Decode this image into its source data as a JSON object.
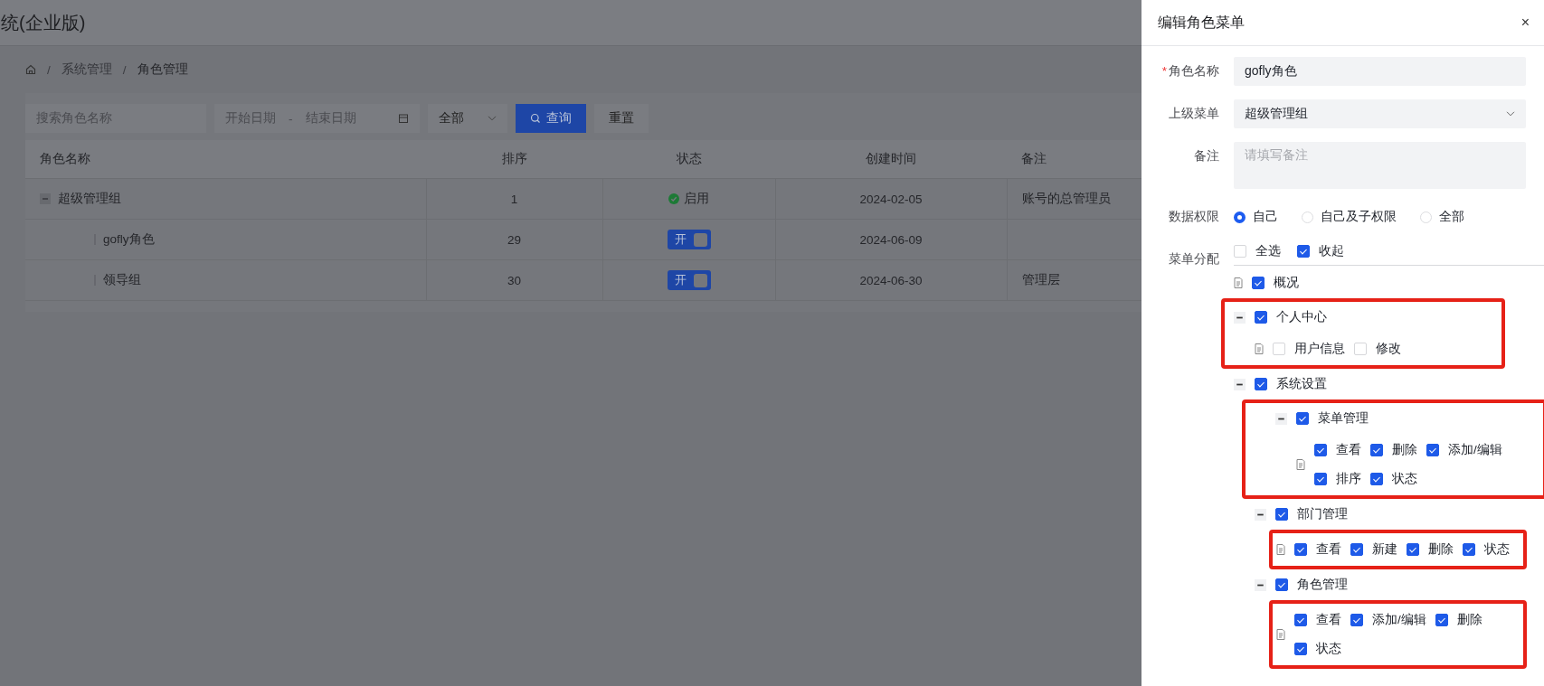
{
  "header": {
    "title": "统(企业版)"
  },
  "breadcrumb": [
    {
      "kind": "home"
    },
    {
      "kind": "link",
      "separator": "/",
      "label": "系统管理"
    },
    {
      "kind": "current",
      "separator": "/",
      "label": "角色管理"
    }
  ],
  "filters": {
    "search": {
      "placeholder": "搜索角色名称"
    },
    "date_range": {
      "start_placeholder": "开始日期",
      "separator": "-",
      "end_placeholder": "结束日期"
    },
    "select": {
      "value": "全部"
    },
    "buttons": [
      {
        "kind": "primary",
        "label": "查询"
      },
      {
        "kind": "default",
        "label": "重置"
      }
    ]
  },
  "table": {
    "columns": [
      "角色名称",
      "排序",
      "状态",
      "创建时间",
      "备注"
    ],
    "rows": [
      {
        "name": "超级管理组",
        "sort": "1",
        "status": {
          "kind": "tag",
          "label": "启用"
        },
        "created": "2024-02-05",
        "note": "账号的总管理员",
        "expanded": true,
        "children": [
          {
            "name": "gofly角色",
            "sort": "29",
            "status": {
              "kind": "switch",
              "label": "开",
              "on": true
            },
            "created": "2024-06-09"
          },
          {
            "name": "领导组",
            "sort": "30",
            "status": {
              "kind": "switch",
              "label": "开",
              "on": true
            },
            "created": "2024-06-30",
            "note": "管理层"
          }
        ]
      }
    ]
  },
  "drawer": {
    "title": "编辑角色菜单",
    "close": "×",
    "role_name": {
      "label": "角色名称",
      "required_mark": "*",
      "value": "gofly角色"
    },
    "parent_menu": {
      "label": "上级菜单",
      "value": "超级管理组"
    },
    "note": {
      "label": "备注",
      "placeholder": "请填写备注"
    },
    "data_scope": {
      "label": "数据权限",
      "options": [
        {
          "label": "自己",
          "selected": true
        },
        {
          "label": "自己及子权限",
          "selected": false
        },
        {
          "label": "全部",
          "selected": false
        }
      ]
    },
    "menu": {
      "label": "菜单分配",
      "toolbar": [
        {
          "label": "全选",
          "checked": false
        },
        {
          "label": "收起",
          "checked": true
        }
      ],
      "tree": [
        {
          "label": "概况",
          "checked": true,
          "framed": false
        },
        {
          "label": "个人中心",
          "checked": true,
          "expanded": true,
          "framed": true,
          "children_framed": false,
          "children": [
            {
              "label": "用户信息",
              "checked": false
            },
            {
              "label": "修改",
              "checked": false
            }
          ]
        },
        {
          "label": "系统设置",
          "checked": true,
          "expanded": true,
          "framed": false,
          "children_framed": false,
          "children": [
            {
              "label": "菜单管理",
              "checked": true,
              "expanded": true,
              "framed": true,
              "children_framed": false,
              "children": [
                {
                  "label": "查看",
                  "checked": true
                },
                {
                  "label": "删除",
                  "checked": true
                },
                {
                  "label": "添加/编辑",
                  "checked": true
                },
                {
                  "label": "排序",
                  "checked": true
                },
                {
                  "label": "状态",
                  "checked": true
                }
              ]
            },
            {
              "label": "部门管理",
              "checked": true,
              "expanded": true,
              "framed": false,
              "children_framed": true,
              "children": [
                {
                  "label": "查看",
                  "checked": true
                },
                {
                  "label": "新建",
                  "checked": true
                },
                {
                  "label": "删除",
                  "checked": true
                },
                {
                  "label": "状态",
                  "checked": true
                }
              ]
            },
            {
              "label": "角色管理",
              "checked": true,
              "expanded": true,
              "framed": false,
              "children_framed": true,
              "children": [
                {
                  "label": "查看",
                  "checked": true
                },
                {
                  "label": "添加/编辑",
                  "checked": true
                },
                {
                  "label": "删除",
                  "checked": true
                },
                {
                  "label": "状态",
                  "checked": true
                }
              ]
            }
          ]
        }
      ]
    }
  }
}
